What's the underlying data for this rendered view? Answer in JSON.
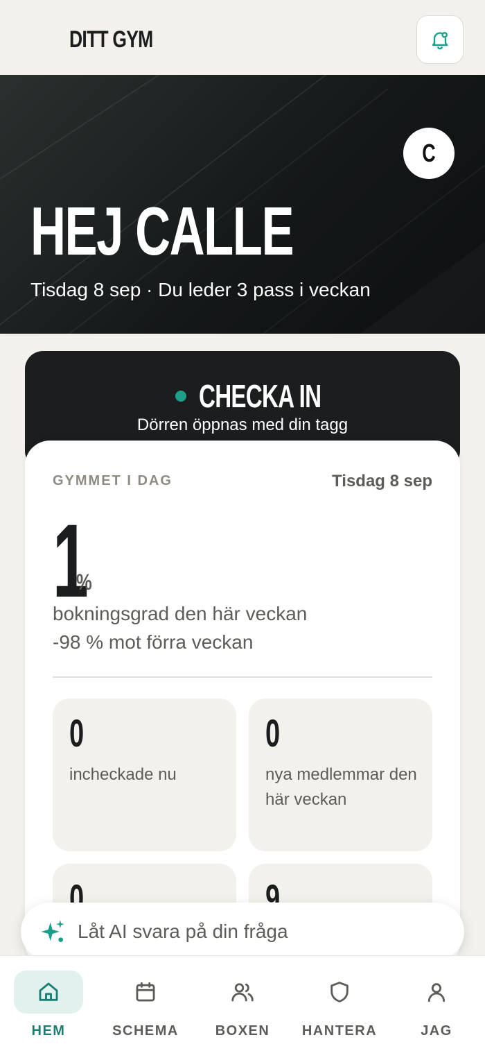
{
  "header": {
    "brand": "DITT GYM",
    "bell_icon": "bell-icon"
  },
  "hero": {
    "avatar_initial": "C",
    "greeting": "HEJ CALLE",
    "subtitle": "Tisdag 8 sep · Du leder 3 pass i veckan"
  },
  "checkin": {
    "title": "CHECKA IN",
    "subtitle": "Dörren öppnas med din tagg",
    "status_color": "#1f9e8a"
  },
  "gym_today": {
    "label": "GYMMET I DAG",
    "date": "Tisdag 8 sep",
    "booking_rate": "1",
    "unit": "%",
    "rate_label": "bokningsgrad den här veckan",
    "comparison": "-98 % mot förra veckan",
    "tiles": [
      {
        "value": "0",
        "label": "incheckade nu"
      },
      {
        "value": "0",
        "label": "nya medlemmar den här veckan"
      },
      {
        "value": "0",
        "label": ""
      },
      {
        "value": "9",
        "label": ""
      }
    ]
  },
  "ai": {
    "icon": "sparkles-icon",
    "placeholder": "Låt AI svara på din fråga"
  },
  "nav": {
    "items": [
      {
        "label": "HEM",
        "icon": "home-icon",
        "active": true
      },
      {
        "label": "SCHEMA",
        "icon": "calendar-icon",
        "active": false
      },
      {
        "label": "BOXEN",
        "icon": "users-icon",
        "active": false
      },
      {
        "label": "HANTERA",
        "icon": "shield-icon",
        "active": false
      },
      {
        "label": "JAG",
        "icon": "user-icon",
        "active": false
      }
    ]
  },
  "colors": {
    "accent": "#1a7f72",
    "accent_bg": "#e1f1ee",
    "background": "#f3f1ec",
    "dark": "#1b1d1f"
  }
}
